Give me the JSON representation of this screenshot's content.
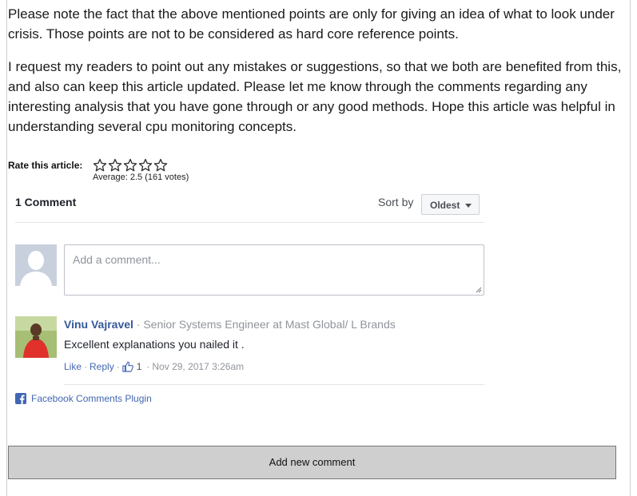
{
  "article": {
    "paragraphs": [
      "Please note the fact that the above mentioned points are only for giving an idea of what to look under crisis. Those points are not to be considered as hard core reference points.",
      "I request my readers to point out any mistakes or suggestions, so that we both are benefited from this, and also can keep this article updated. Please let me know through the comments regarding any interesting analysis that you have gone through or any good methods. Hope this article was helpful in understanding several cpu monitoring concepts."
    ]
  },
  "rating": {
    "label": "Rate this article:",
    "stars_total": 5,
    "stars_filled": 0,
    "average_text": "Average: 2.5 (161 votes)"
  },
  "comments": {
    "count_label": "1 Comment",
    "sort_label": "Sort by",
    "sort_value": "Oldest",
    "input_placeholder": "Add a comment...",
    "items": [
      {
        "author": "Vinu Vajravel",
        "author_title": " · Senior Systems Engineer at Mast Global/ L Brands",
        "text": "Excellent explanations you nailed it .",
        "like_label": "Like",
        "reply_label": "Reply",
        "like_count": "1",
        "timestamp": "Nov 29, 2017 3:26am"
      }
    ],
    "plugin_label": "Facebook Comments Plugin"
  },
  "add_comment_button": "Add new comment",
  "colors": {
    "facebook_link": "#365899",
    "facebook_blue": "#4267b2",
    "muted_text": "#90949c",
    "button_bg": "#cfcfcf"
  }
}
